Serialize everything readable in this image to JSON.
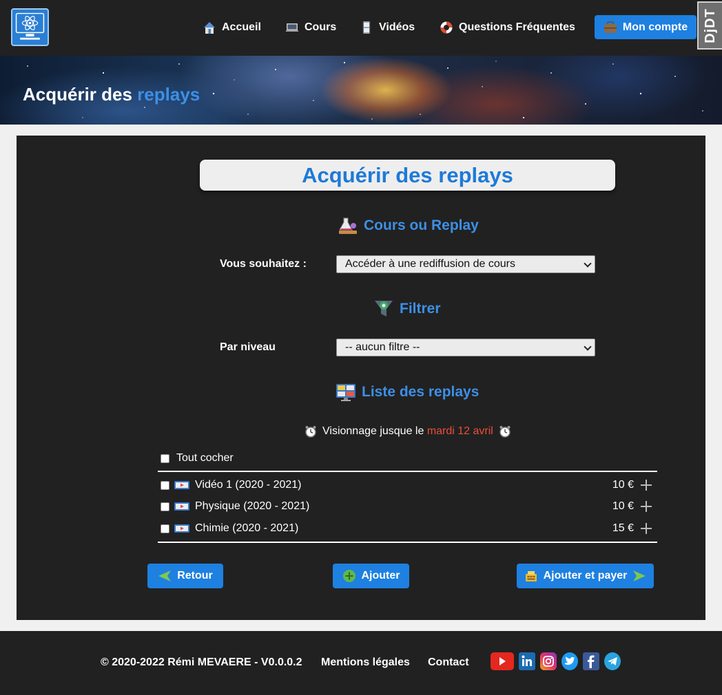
{
  "nav": {
    "items": [
      {
        "label": "Accueil",
        "icon": "house-icon"
      },
      {
        "label": "Cours",
        "icon": "laptop-icon"
      },
      {
        "label": "Vidéos",
        "icon": "film-icon"
      },
      {
        "label": "Questions Fréquentes",
        "icon": "lifebuoy-icon"
      }
    ],
    "account_label": "Mon compte",
    "debug_toolbar": "DjDT"
  },
  "hero": {
    "title_part1": "Acquérir des ",
    "title_part2": "replays"
  },
  "main": {
    "title": "Acquérir des replays",
    "section_cours": "Cours ou Replay",
    "wish_label": "Vous souhaitez :",
    "wish_selected": "Accéder à une rediffusion de cours",
    "section_filtre": "Filtrer",
    "level_label": "Par niveau",
    "level_selected": "-- aucun filtre --",
    "section_liste": "Liste des replays",
    "deadline_prefix": "Visionnage jusque le ",
    "deadline_date": "mardi 12 avril",
    "check_all": "Tout cocher",
    "replays": [
      {
        "title": "Vidéo 1 (2020 - 2021)",
        "price": "10 €",
        "checked": false
      },
      {
        "title": "Physique (2020 - 2021)",
        "price": "10 €",
        "checked": false
      },
      {
        "title": "Chimie (2020 - 2021)",
        "price": "15 €",
        "checked": false
      }
    ],
    "buttons": {
      "back": "Retour",
      "add": "Ajouter",
      "add_pay": "Ajouter et payer"
    }
  },
  "footer": {
    "copyright": "© 2020-2022 Rémi MEVAERE - V0.0.0.2",
    "legal": "Mentions légales",
    "contact": "Contact",
    "social": [
      "youtube-icon",
      "linkedin-icon",
      "instagram-icon",
      "twitter-icon",
      "facebook-icon",
      "telegram-icon"
    ]
  },
  "colors": {
    "accent": "#1e80e0",
    "title_blue": "#1e7ad8",
    "date_red": "#e8503a",
    "dark_bg": "#212121"
  }
}
